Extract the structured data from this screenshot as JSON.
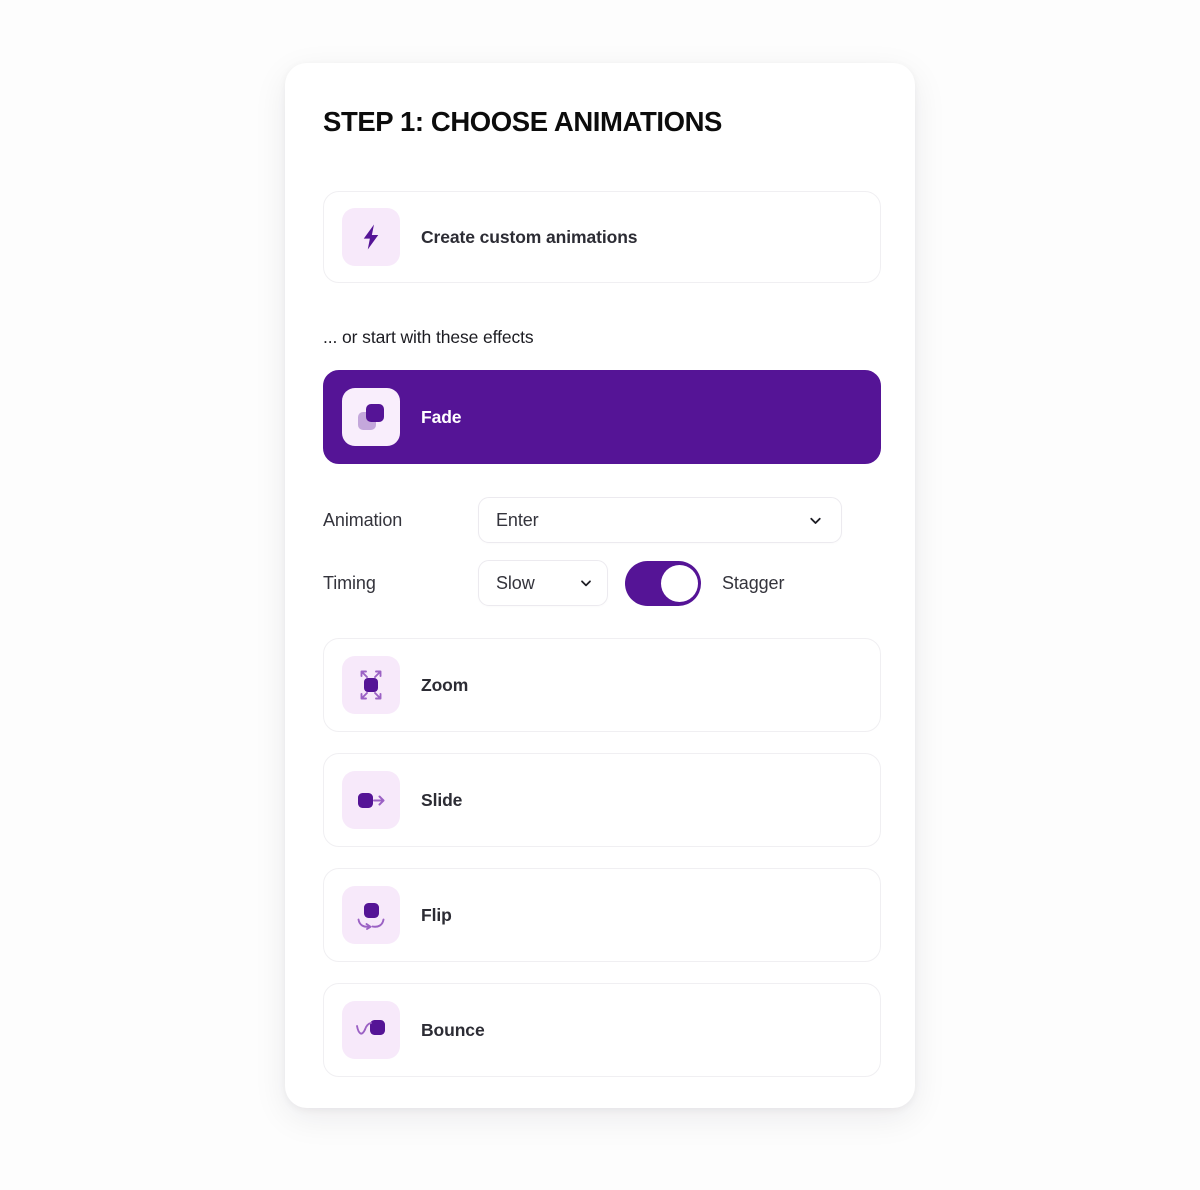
{
  "panel": {
    "title": "STEP 1: CHOOSE ANIMATIONS",
    "hint": "... or start with these effects"
  },
  "custom": {
    "label": "Create custom animations",
    "icon": "lightning-bolt-icon"
  },
  "selected_effect": {
    "label": "Fade",
    "icon": "fade-squares-icon"
  },
  "controls": {
    "animation": {
      "label": "Animation",
      "value": "Enter",
      "chevron": "chevron-down-icon"
    },
    "timing": {
      "label": "Timing",
      "value": "Slow",
      "chevron": "chevron-down-icon"
    },
    "stagger": {
      "label": "Stagger",
      "enabled": true
    }
  },
  "effects": [
    {
      "label": "Zoom",
      "icon": "zoom-expand-icon"
    },
    {
      "label": "Slide",
      "icon": "slide-arrow-icon"
    },
    {
      "label": "Flip",
      "icon": "flip-rotate-icon"
    },
    {
      "label": "Bounce",
      "icon": "bounce-curve-icon"
    }
  ],
  "colors": {
    "accent_purple": "#551496",
    "icon_tile_bg": "#f7e9fa",
    "panel_bg": "#ffffff",
    "page_bg": "#fdfdfd",
    "text_dark": "#2c2c34"
  }
}
